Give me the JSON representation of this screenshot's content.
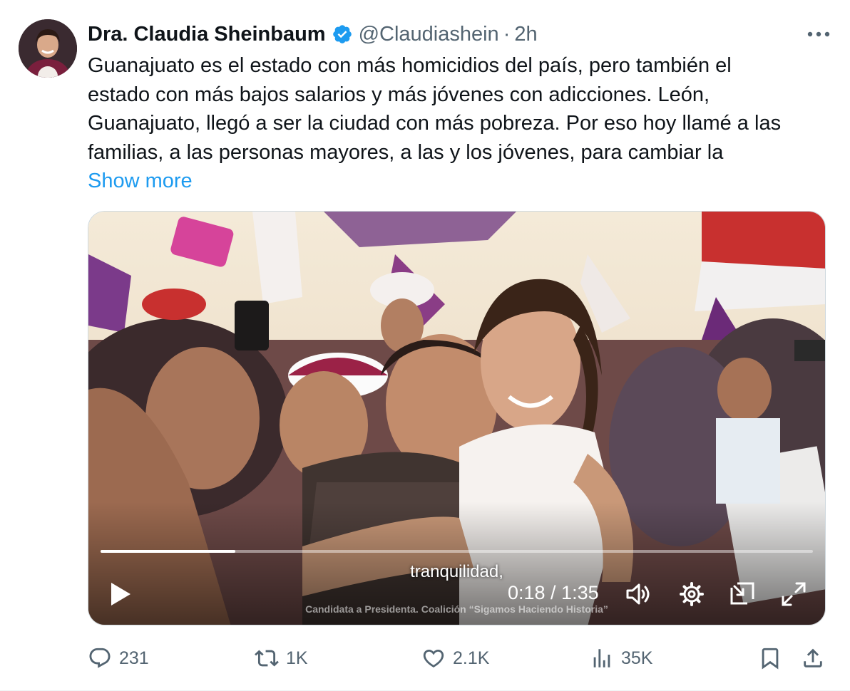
{
  "tweet": {
    "display_name": "Dra. Claudia Sheinbaum",
    "verified_icon": "verified-badge-icon",
    "handle": "@Claudiashein",
    "separator": "·",
    "timestamp": "2h",
    "text_lines": [
      "Guanajuato es el estado con más homicidios del país, pero también el",
      "estado con más bajos salarios y más jóvenes con adicciones. León,",
      "Guanajuato, llegó a ser la ciudad con más pobreza. Por eso hoy llamé a las",
      "familias, a las personas mayores, a las y los jóvenes, para cambiar la"
    ],
    "show_more_label": "Show more"
  },
  "video": {
    "caption": "tranquilidad,",
    "credit": "Candidata a Presidenta. Coalición “Sigamos Haciendo Historia”",
    "current_time": "0:18",
    "time_separator": "/",
    "duration": "1:35",
    "timecode": "0:18 / 1:35",
    "progress_fraction": 0.189
  },
  "actions": {
    "replies": "231",
    "reposts": "1K",
    "likes": "2.1K",
    "views": "35K"
  },
  "colors": {
    "text_primary": "#0f1419",
    "text_secondary": "#536471",
    "link": "#1d9bf0",
    "verified": "#1d9bf0",
    "campaign_maroon": "#9b2247",
    "campaign_purple": "#6b3a7a"
  }
}
